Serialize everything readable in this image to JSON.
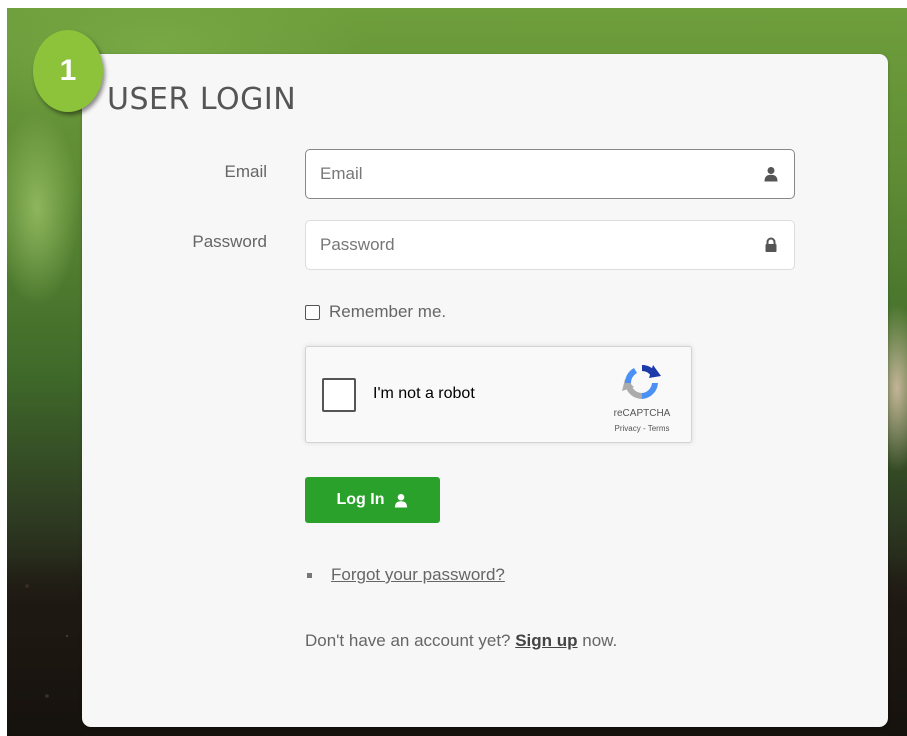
{
  "badge": {
    "number": "1",
    "color": "#8cc33a"
  },
  "title": "USER LOGIN",
  "form": {
    "email": {
      "label": "Email",
      "placeholder": "Email",
      "value": "",
      "icon": "user-icon"
    },
    "password": {
      "label": "Password",
      "placeholder": "Password",
      "value": "",
      "icon": "lock-icon"
    },
    "remember": {
      "label": "Remember me.",
      "checked": false
    },
    "recaptcha": {
      "label": "I'm not a robot",
      "brand": "reCAPTCHA",
      "privacy": "Privacy",
      "separator": " - ",
      "terms": "Terms"
    },
    "submit": {
      "label": "Log In",
      "icon": "user-icon",
      "color": "#2aa12a"
    }
  },
  "links": {
    "forgot": "Forgot your password?",
    "signup_prefix": "Don't have an account yet? ",
    "signup_link": "Sign up",
    "signup_suffix": " now."
  }
}
